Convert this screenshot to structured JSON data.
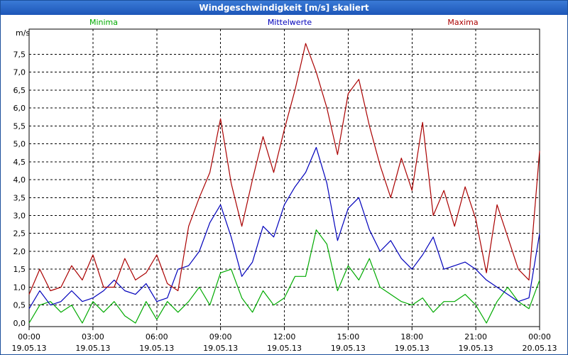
{
  "window": {
    "title": "Windgeschwindigkeit [m/s] skaliert"
  },
  "chart_data": {
    "type": "line",
    "title": "Windgeschwindigkeit [m/s] skaliert",
    "ylabel": "m/s",
    "xlabel": "",
    "ylim": [
      -0.1,
      8.2
    ],
    "yticks": [
      "0,0",
      "0,5",
      "1,0",
      "1,5",
      "2,0",
      "2,5",
      "3,0",
      "3,5",
      "4,0",
      "4,5",
      "5,0",
      "5,5",
      "6,0",
      "6,5",
      "7,0",
      "7,5"
    ],
    "xticks": [
      {
        "time": "00:00",
        "date": "19.05.13"
      },
      {
        "time": "03:00",
        "date": "19.05.13"
      },
      {
        "time": "06:00",
        "date": "19.05.13"
      },
      {
        "time": "09:00",
        "date": "19.05.13"
      },
      {
        "time": "12:00",
        "date": "19.05.13"
      },
      {
        "time": "15:00",
        "date": "19.05.13"
      },
      {
        "time": "18:00",
        "date": "19.05.13"
      },
      {
        "time": "21:00",
        "date": "19.05.13"
      },
      {
        "time": "00:00",
        "date": "20.05.13"
      }
    ],
    "grid": true,
    "legend_position": "top",
    "x_unit": "hours",
    "series": [
      {
        "name": "Minima",
        "color": "#00aa00",
        "x": [
          0,
          0.5,
          1,
          1.5,
          2,
          2.5,
          3,
          3.5,
          4,
          4.5,
          5,
          5.5,
          6,
          6.5,
          7,
          7.5,
          8,
          8.5,
          9,
          9.5,
          10,
          10.5,
          11,
          11.5,
          12,
          12.5,
          13,
          13.5,
          14,
          14.5,
          15,
          15.5,
          16,
          16.5,
          17,
          17.5,
          18,
          18.5,
          19,
          19.5,
          20,
          20.5,
          21,
          21.5,
          22,
          22.5,
          23,
          23.5,
          24
        ],
        "values": [
          0.0,
          0.5,
          0.6,
          0.3,
          0.5,
          0.0,
          0.6,
          0.3,
          0.6,
          0.2,
          0.0,
          0.6,
          0.1,
          0.6,
          0.3,
          0.6,
          1.0,
          0.5,
          1.4,
          1.5,
          0.7,
          0.3,
          0.9,
          0.5,
          0.7,
          1.3,
          1.3,
          2.6,
          2.2,
          0.9,
          1.6,
          1.2,
          1.8,
          1.0,
          0.8,
          0.6,
          0.5,
          0.7,
          0.3,
          0.6,
          0.6,
          0.8,
          0.5,
          0.0,
          0.6,
          1.0,
          0.6,
          0.4,
          1.2
        ]
      },
      {
        "name": "Mittelwerte",
        "color": "#0000bb",
        "x": [
          0,
          0.5,
          1,
          1.5,
          2,
          2.5,
          3,
          3.5,
          4,
          4.5,
          5,
          5.5,
          6,
          6.5,
          7,
          7.5,
          8,
          8.5,
          9,
          9.5,
          10,
          10.5,
          11,
          11.5,
          12,
          12.5,
          13,
          13.5,
          14,
          14.5,
          15,
          15.5,
          16,
          16.5,
          17,
          17.5,
          18,
          18.5,
          19,
          19.5,
          20,
          20.5,
          21,
          21.5,
          22,
          22.5,
          23,
          23.5,
          24
        ],
        "values": [
          0.4,
          0.9,
          0.5,
          0.6,
          0.9,
          0.6,
          0.7,
          0.9,
          1.2,
          0.9,
          0.8,
          1.1,
          0.6,
          0.7,
          1.5,
          1.6,
          2.0,
          2.8,
          3.3,
          2.4,
          1.3,
          1.7,
          2.7,
          2.4,
          3.3,
          3.8,
          4.2,
          4.9,
          3.9,
          2.3,
          3.2,
          3.5,
          2.6,
          2.0,
          2.3,
          1.8,
          1.5,
          1.9,
          2.4,
          1.5,
          1.6,
          1.7,
          1.5,
          1.2,
          1.0,
          0.8,
          0.6,
          0.7,
          2.5
        ]
      },
      {
        "name": "Maxima",
        "color": "#aa0000",
        "x": [
          0,
          0.5,
          1,
          1.5,
          2,
          2.5,
          3,
          3.5,
          4,
          4.5,
          5,
          5.5,
          6,
          6.5,
          7,
          7.5,
          8,
          8.5,
          9,
          9.5,
          10,
          10.5,
          11,
          11.5,
          12,
          12.5,
          13,
          13.5,
          14,
          14.5,
          15,
          15.5,
          16,
          16.5,
          17,
          17.5,
          18,
          18.5,
          19,
          19.5,
          20,
          20.5,
          21,
          21.5,
          22,
          22.5,
          23,
          23.5,
          24
        ],
        "values": [
          0.8,
          1.5,
          0.9,
          1.0,
          1.6,
          1.2,
          1.9,
          1.0,
          1.0,
          1.8,
          1.2,
          1.4,
          1.9,
          1.1,
          0.9,
          2.7,
          3.5,
          4.2,
          5.7,
          3.9,
          2.7,
          4.0,
          5.2,
          4.2,
          5.4,
          6.5,
          7.8,
          7.0,
          6.0,
          4.7,
          6.4,
          6.8,
          5.5,
          4.4,
          3.5,
          4.6,
          3.7,
          5.6,
          3.0,
          3.7,
          2.7,
          3.8,
          2.9,
          1.4,
          3.3,
          2.4,
          1.5,
          1.2,
          4.8
        ]
      }
    ]
  }
}
